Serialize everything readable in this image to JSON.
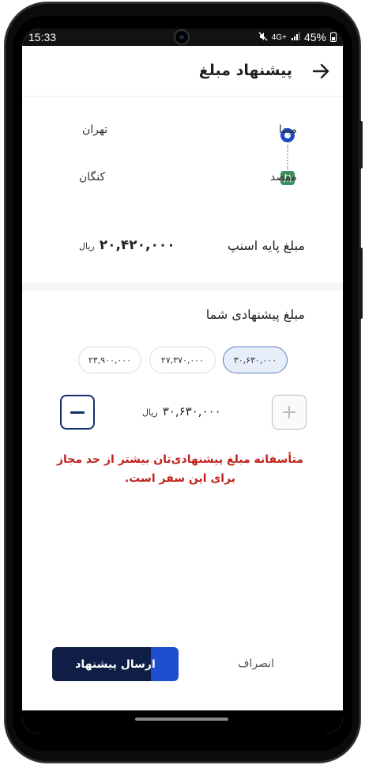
{
  "status_bar": {
    "time": "15:33",
    "network": "4G+",
    "battery": "45%",
    "icons": [
      "mute-icon",
      "network-icon",
      "signal-icon",
      "battery-icon"
    ]
  },
  "header": {
    "title": "پیشنهاد مبلغ",
    "back_icon": "arrow-right-icon"
  },
  "route": {
    "origin_label": "مبدا",
    "origin_value": "تهران",
    "destination_label": "مقصد",
    "destination_value": "کنگان",
    "origin_icon": "origin-dot-icon",
    "destination_icon": "highway-icon"
  },
  "base_fare": {
    "label": "مبلغ پایه اسنپ",
    "amount": "۲۰,۴۲۰,۰۰۰",
    "unit": "ریال"
  },
  "offer": {
    "title": "مبلغ پیشنهادی شما",
    "chips": [
      {
        "label": "۳۰,۶۳۰,۰۰۰",
        "selected": true
      },
      {
        "label": "۲۷,۳۷۰,۰۰۰",
        "selected": false
      },
      {
        "label": "۲۳,۹۰۰,۰۰۰",
        "selected": false
      }
    ],
    "current_amount": "۳۰,۶۳۰,۰۰۰",
    "unit": "ریال",
    "error": "متأسفانه مبلغ پیشنهادی‌تان بیشتر از حد مجاز برای این سفر است."
  },
  "actions": {
    "cancel_label": "انصراف",
    "submit_label": "ارسال پیشنهاد"
  },
  "colors": {
    "accent": "#1a49c4",
    "submit_dark": "#0e1e45",
    "error": "#c0211b",
    "chip_selected_bg": "#e7eef9"
  }
}
